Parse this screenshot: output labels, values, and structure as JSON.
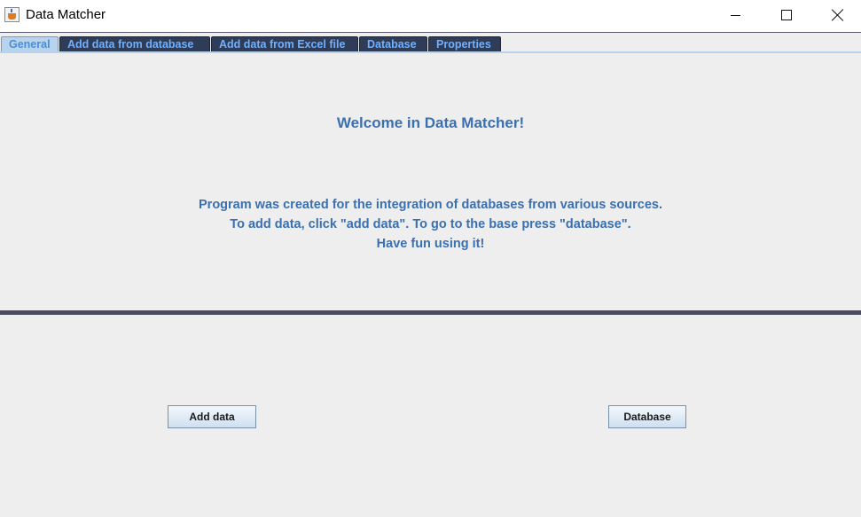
{
  "window": {
    "title": "Data Matcher",
    "icon": "java-icon"
  },
  "tabs": [
    {
      "label": "General",
      "active": true
    },
    {
      "label": "Add data from database",
      "active": false
    },
    {
      "label": "Add data from Excel file",
      "active": false
    },
    {
      "label": "Database",
      "active": false
    },
    {
      "label": "Properties",
      "active": false
    }
  ],
  "main": {
    "welcome": "Welcome in Data Matcher!",
    "lines": [
      "Program was created for the integration of databases from various sources.",
      "To add data, click \"add data\". To go to the base press \"database\".",
      "Have fun using it!"
    ]
  },
  "buttons": {
    "add_data": "Add data",
    "database": "Database"
  },
  "colors": {
    "accent_text": "#3a6fb0",
    "tab_bg": "#2f3c57",
    "tab_text": "#6fb0ff",
    "active_tab_bg": "#b8d3ee",
    "divider": "#4a4a5e"
  }
}
